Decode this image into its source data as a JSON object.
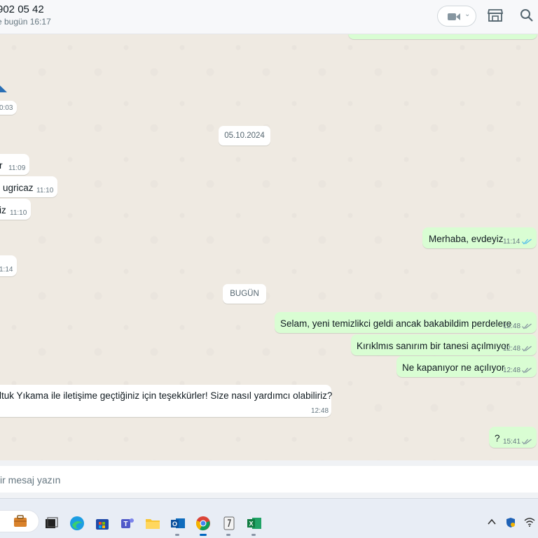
{
  "header": {
    "contact_name": "902 05 42",
    "last_seen": "e bugün 16:17"
  },
  "chat": {
    "partial_time_top": "0:03",
    "date_pill_1": "05.10.2024",
    "incoming_1": {
      "text": "r",
      "time": "11:09"
    },
    "incoming_2": {
      "text": "ugricaz",
      "time": "11:10"
    },
    "incoming_3": {
      "text": "iz",
      "time": "11:10"
    },
    "incoming_4_time": "1:14",
    "outgoing_1": {
      "text": "Merhaba, evdeyiz",
      "time": "11:14"
    },
    "date_pill_2": "BUGÜN",
    "outgoing_2": {
      "text": "Selam, yeni temizlikci geldi ancak bakabildim perdelere",
      "time": "12:48"
    },
    "outgoing_3": {
      "text": "Kırıklmıs sanırım bir tanesi açılmıyor",
      "time": "12:48"
    },
    "outgoing_4": {
      "text": "Ne kapanıyor ne açılıyor",
      "time": "12:48"
    },
    "incoming_5": {
      "text": "ltuk Yıkama ile iletişime geçtiğiniz için teşekkürler! Size nasıl yardımcı olabiliriz?",
      "time": "12:48"
    },
    "outgoing_5": {
      "text": "?",
      "time": "15:41"
    }
  },
  "composer": {
    "placeholder": "ir mesaj yazın"
  },
  "colors": {
    "outgoing_bubble": "#d9fdd3",
    "incoming_bubble": "#ffffff",
    "read_ticks": "#53bdeb",
    "chat_bg": "#efeae2"
  },
  "taskbar": {
    "icons": [
      "briefcase-icon",
      "task-view-icon",
      "edge-icon",
      "store-icon",
      "teams-icon",
      "file-explorer-icon",
      "outlook-icon",
      "chrome-icon",
      "app-icon",
      "excel-icon"
    ],
    "tray": [
      "chevron-up-icon",
      "security-icon",
      "wifi-icon"
    ]
  }
}
